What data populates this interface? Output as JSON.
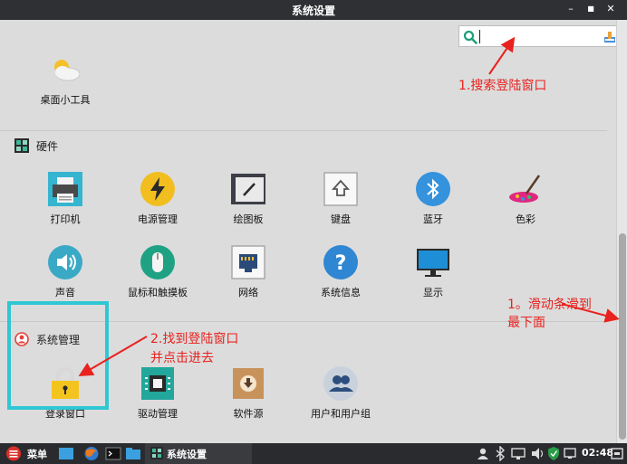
{
  "window": {
    "title": "系统设置",
    "minimize_glyph": "–",
    "maximize_glyph": "■",
    "close_glyph": "✕"
  },
  "search": {
    "placeholder": "",
    "value": ""
  },
  "personal_items": [
    {
      "label": "桌面小工具",
      "icon": "widget-cloud-icon"
    }
  ],
  "hardware": {
    "title": "硬件",
    "items": [
      {
        "label": "打印机",
        "icon": "printer-icon"
      },
      {
        "label": "电源管理",
        "icon": "power-icon"
      },
      {
        "label": "绘图板",
        "icon": "tablet-icon"
      },
      {
        "label": "键盘",
        "icon": "keyboard-icon"
      },
      {
        "label": "蓝牙",
        "icon": "bluetooth-icon"
      },
      {
        "label": "色彩",
        "icon": "color-icon"
      },
      {
        "label": "声音",
        "icon": "sound-icon"
      },
      {
        "label": "鼠标和触摸板",
        "icon": "mouse-icon"
      },
      {
        "label": "网络",
        "icon": "network-icon"
      },
      {
        "label": "系统信息",
        "icon": "system-info-icon"
      },
      {
        "label": "显示",
        "icon": "display-icon"
      }
    ]
  },
  "system_admin": {
    "title": "系统管理",
    "items": [
      {
        "label": "登录窗口",
        "icon": "lock-icon"
      },
      {
        "label": "驱动管理",
        "icon": "chip-icon"
      },
      {
        "label": "软件源",
        "icon": "software-source-icon"
      },
      {
        "label": "用户和用户组",
        "icon": "users-icon"
      }
    ]
  },
  "annotations": {
    "search_hint": "1.搜索登陆窗口",
    "scroll_hint_line1": "1。滑动条滑到",
    "scroll_hint_line2": "最下面",
    "find_hint_line1": "2.找到登陆窗口",
    "find_hint_line2": "并点击进去"
  },
  "taskbar": {
    "menu_label": "菜单",
    "app_label": "系统设置",
    "clock": "02:48"
  },
  "colors": {
    "annotation": "#e8221e",
    "highlight": "#2ec7d3",
    "titlebar": "#2f3033",
    "taskbar": "#2a2b2e"
  }
}
